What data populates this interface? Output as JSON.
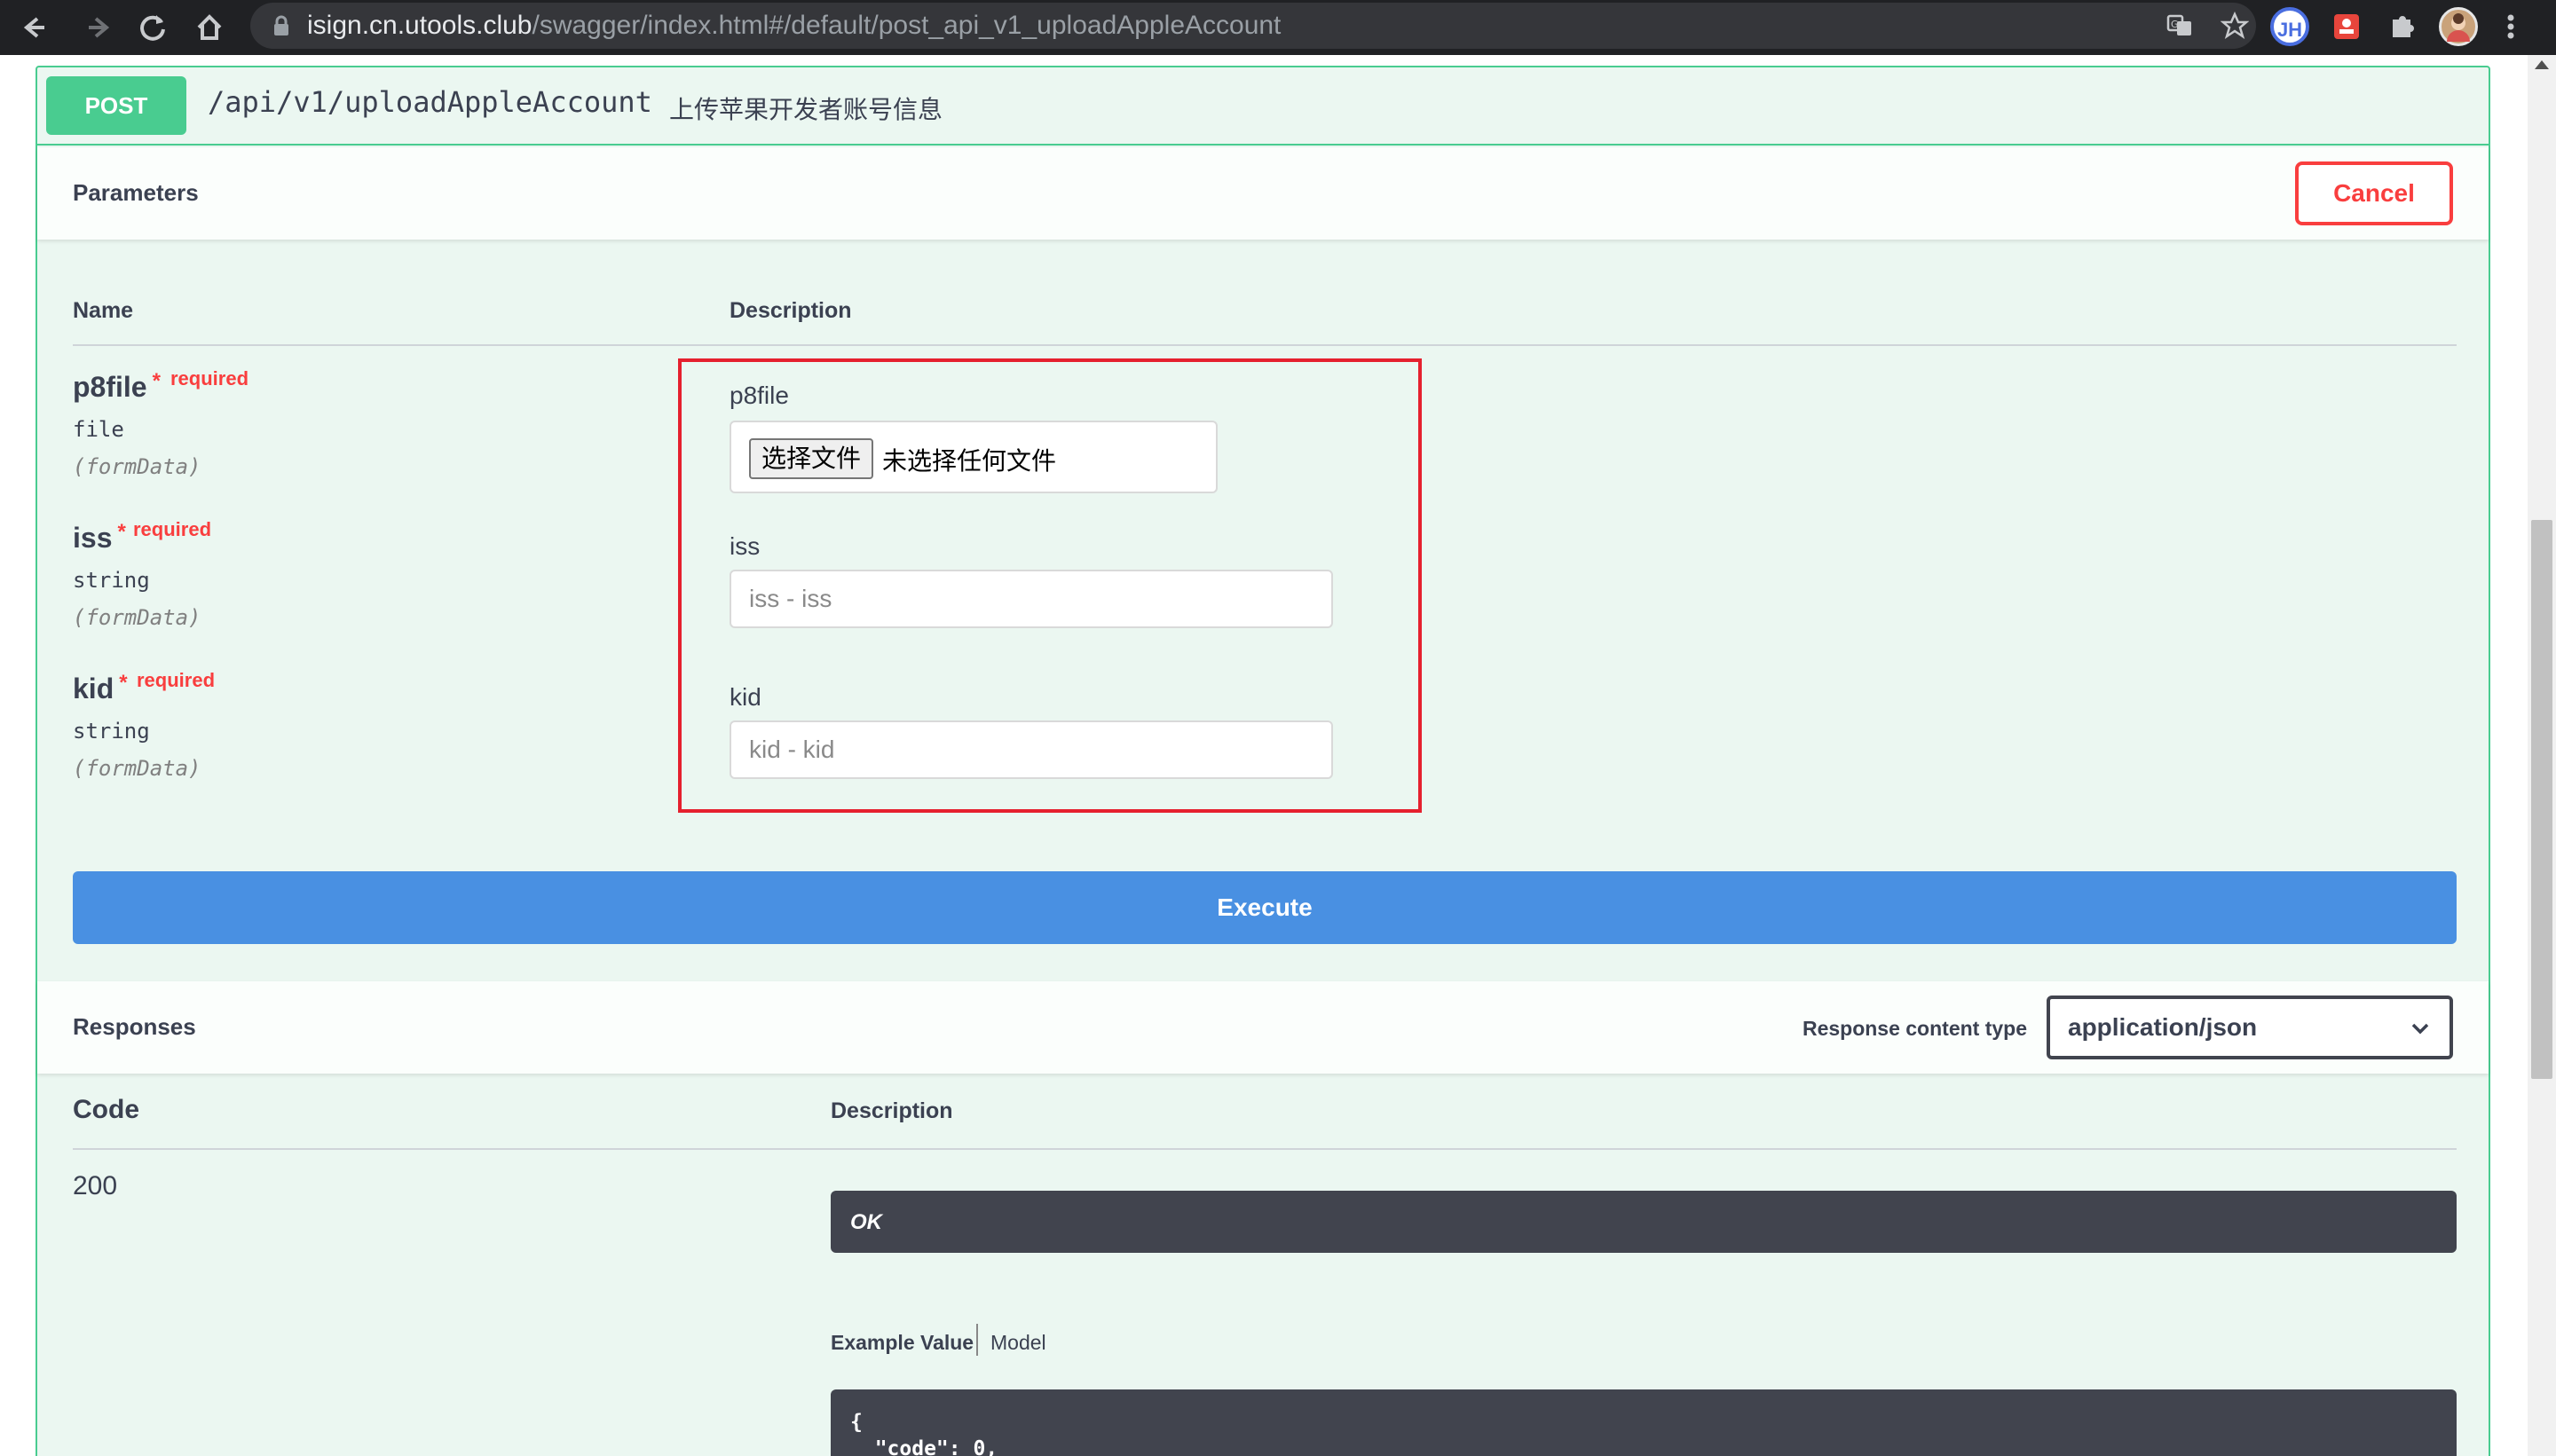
{
  "browser": {
    "url_host": "isign.cn.utools.club",
    "url_path": "/swagger/index.html#/default/post_api_v1_uploadAppleAccount",
    "profile_badge": "JH"
  },
  "operation": {
    "method": "POST",
    "path": "/api/v1/uploadAppleAccount",
    "description": "上传苹果开发者账号信息"
  },
  "parameters": {
    "title": "Parameters",
    "cancel_label": "Cancel",
    "col_name": "Name",
    "col_description": "Description",
    "required_star": "*",
    "items": [
      {
        "name": "p8file",
        "required": "required",
        "type": "file",
        "in": "(formData)",
        "label": "p8file",
        "button": "选择文件",
        "status": "未选择任何文件"
      },
      {
        "name": "iss",
        "required": "required",
        "type": "string",
        "in": "(formData)",
        "label": "iss",
        "placeholder": "iss - iss"
      },
      {
        "name": "kid",
        "required": "required",
        "type": "string",
        "in": "(formData)",
        "label": "kid",
        "placeholder": "kid - kid"
      }
    ],
    "execute_label": "Execute"
  },
  "responses": {
    "title": "Responses",
    "content_type_label": "Response content type",
    "content_type_value": "application/json",
    "col_code": "Code",
    "col_description": "Description",
    "code": "200",
    "code_desc": "OK",
    "tab_example": "Example Value",
    "tab_model": "Model",
    "example_lines": "{\n  \"code\": 0,"
  },
  "colors": {
    "post": "#49cc90",
    "post_bg": "#ebf7f1",
    "cancel": "#f93e3e",
    "execute": "#4990e2",
    "highlight": "#e5202e",
    "dark_box": "#41444e"
  }
}
